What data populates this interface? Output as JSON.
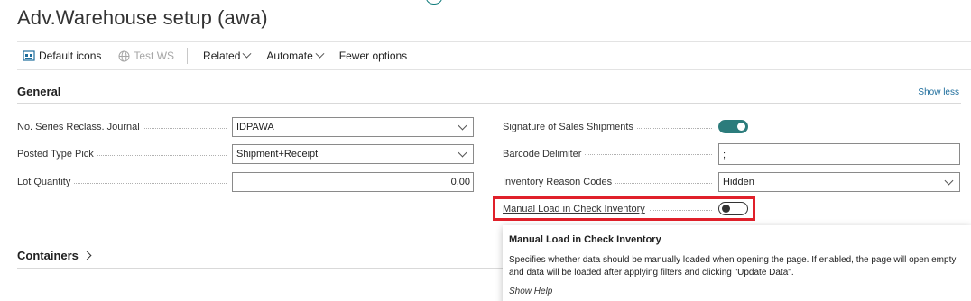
{
  "page": {
    "title": "Adv.Warehouse setup (awa)"
  },
  "toolbar": {
    "default_icons": "Default icons",
    "test_ws": "Test WS",
    "related": "Related",
    "automate": "Automate",
    "fewer_options": "Fewer options"
  },
  "general": {
    "title": "General",
    "show_less": "Show less",
    "left_fields": {
      "no_series_label": "No. Series Reclass. Journal",
      "no_series_value": "IDPAWA",
      "posted_type_label": "Posted Type Pick",
      "posted_type_value": "Shipment+Receipt",
      "lot_qty_label": "Lot Quantity",
      "lot_qty_value": "0,00"
    },
    "right_fields": {
      "signature_label": "Signature of Sales Shipments",
      "signature_on": true,
      "barcode_label": "Barcode Delimiter",
      "barcode_value": ";",
      "inv_reason_label": "Inventory Reason Codes",
      "inv_reason_value": "Hidden",
      "manual_load_label": "Manual Load in Check Inventory",
      "manual_load_on": false
    }
  },
  "containers": {
    "title": "Containers"
  },
  "tooltip": {
    "title": "Manual Load in Check Inventory",
    "body": "Specifies whether data should be manually loaded when opening the page. If enabled, the page will open empty and data will be loaded after applying filters and clicking \"Update Data\".",
    "help": "Show Help"
  },
  "colors": {
    "accent": "#2c7c7c",
    "highlight": "#e0202a",
    "link": "#1e6d9c"
  }
}
